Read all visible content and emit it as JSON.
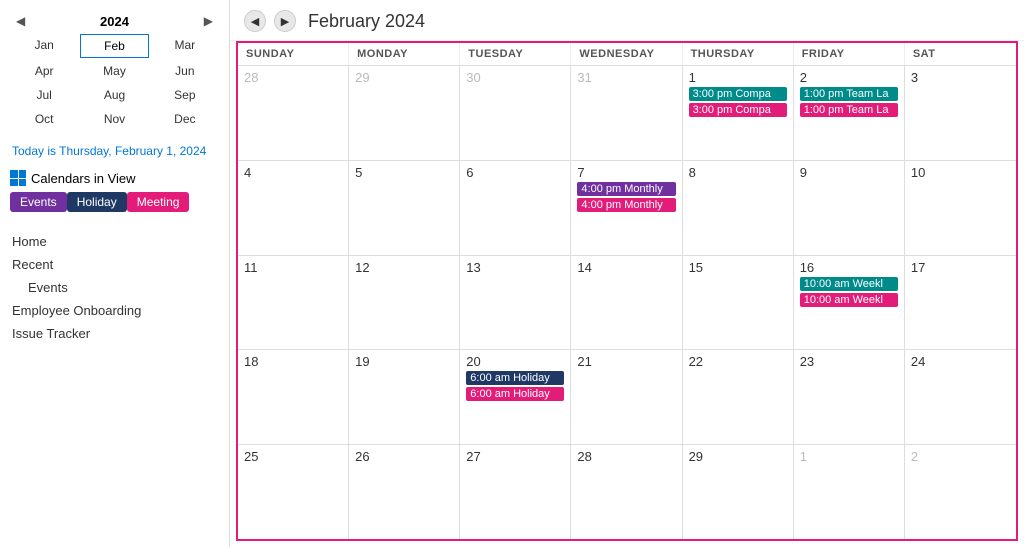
{
  "sidebar": {
    "year": "2024",
    "months": [
      {
        "label": "Jan",
        "selected": false
      },
      {
        "label": "Feb",
        "selected": true
      },
      {
        "label": "Mar",
        "selected": false
      },
      {
        "label": "Apr",
        "selected": false
      },
      {
        "label": "May",
        "selected": false
      },
      {
        "label": "Jun",
        "selected": false
      },
      {
        "label": "Jul",
        "selected": false
      },
      {
        "label": "Aug",
        "selected": false
      },
      {
        "label": "Sep",
        "selected": false
      },
      {
        "label": "Oct",
        "selected": false
      },
      {
        "label": "Nov",
        "selected": false
      },
      {
        "label": "Dec",
        "selected": false
      }
    ],
    "today_prefix": "Today is ",
    "today_value": "Thursday, February 1, 2024",
    "calendars_title": "Calendars in View",
    "badges": [
      {
        "label": "Events",
        "class": "badge-events"
      },
      {
        "label": "Holiday",
        "class": "badge-holiday"
      },
      {
        "label": "Meeting",
        "class": "badge-meeting"
      }
    ],
    "nav_links": [
      {
        "label": "Home",
        "indent": false
      },
      {
        "label": "Recent",
        "indent": false
      },
      {
        "label": "Events",
        "indent": true
      },
      {
        "label": "Employee Onboarding",
        "indent": false
      },
      {
        "label": "Issue Tracker",
        "indent": false
      }
    ]
  },
  "calendar": {
    "title": "February 2024",
    "day_headers": [
      "SUNDAY",
      "MONDAY",
      "TUESDAY",
      "WEDNESDAY",
      "THURSDAY",
      "FRIDAY",
      "SAT"
    ],
    "weeks": [
      {
        "days": [
          {
            "num": "28",
            "other": true,
            "events": []
          },
          {
            "num": "29",
            "other": true,
            "events": []
          },
          {
            "num": "30",
            "other": true,
            "events": []
          },
          {
            "num": "31",
            "other": true,
            "events": []
          },
          {
            "num": "1",
            "other": false,
            "events": [
              {
                "label": "3:00 pm Compa",
                "color": "teal"
              },
              {
                "label": "3:00 pm Compa",
                "color": "pink"
              }
            ]
          },
          {
            "num": "2",
            "other": false,
            "events": [
              {
                "label": "1:00 pm Team La",
                "color": "teal"
              },
              {
                "label": "1:00 pm Team La",
                "color": "pink"
              }
            ]
          },
          {
            "num": "3",
            "other": false,
            "events": []
          }
        ]
      },
      {
        "days": [
          {
            "num": "4",
            "other": false,
            "events": []
          },
          {
            "num": "5",
            "other": false,
            "events": []
          },
          {
            "num": "6",
            "other": false,
            "events": []
          },
          {
            "num": "7",
            "other": false,
            "events": [
              {
                "label": "4:00 pm Monthly",
                "color": "purple"
              },
              {
                "label": "4:00 pm Monthly",
                "color": "pink"
              }
            ]
          },
          {
            "num": "8",
            "other": false,
            "events": []
          },
          {
            "num": "9",
            "other": false,
            "events": []
          },
          {
            "num": "10",
            "other": false,
            "events": []
          }
        ]
      },
      {
        "days": [
          {
            "num": "11",
            "other": false,
            "events": []
          },
          {
            "num": "12",
            "other": false,
            "events": []
          },
          {
            "num": "13",
            "other": false,
            "events": []
          },
          {
            "num": "14",
            "other": false,
            "events": []
          },
          {
            "num": "15",
            "other": false,
            "events": []
          },
          {
            "num": "16",
            "other": false,
            "events": [
              {
                "label": "10:00 am Weekl",
                "color": "teal"
              },
              {
                "label": "10:00 am Weekl",
                "color": "pink"
              }
            ]
          },
          {
            "num": "17",
            "other": false,
            "events": []
          }
        ]
      },
      {
        "days": [
          {
            "num": "18",
            "other": false,
            "events": []
          },
          {
            "num": "19",
            "other": false,
            "events": []
          },
          {
            "num": "20",
            "other": false,
            "events": [
              {
                "label": "6:00 am Holiday",
                "color": "dark-teal"
              },
              {
                "label": "6:00 am Holiday",
                "color": "pink"
              }
            ]
          },
          {
            "num": "21",
            "other": false,
            "events": []
          },
          {
            "num": "22",
            "other": false,
            "events": []
          },
          {
            "num": "23",
            "other": false,
            "events": []
          },
          {
            "num": "24",
            "other": false,
            "events": []
          }
        ]
      },
      {
        "days": [
          {
            "num": "25",
            "other": false,
            "events": []
          },
          {
            "num": "26",
            "other": false,
            "events": []
          },
          {
            "num": "27",
            "other": false,
            "events": []
          },
          {
            "num": "28",
            "other": false,
            "events": []
          },
          {
            "num": "29",
            "other": false,
            "events": []
          },
          {
            "num": "1",
            "other": true,
            "events": []
          },
          {
            "num": "2",
            "other": true,
            "events": []
          }
        ]
      }
    ]
  }
}
